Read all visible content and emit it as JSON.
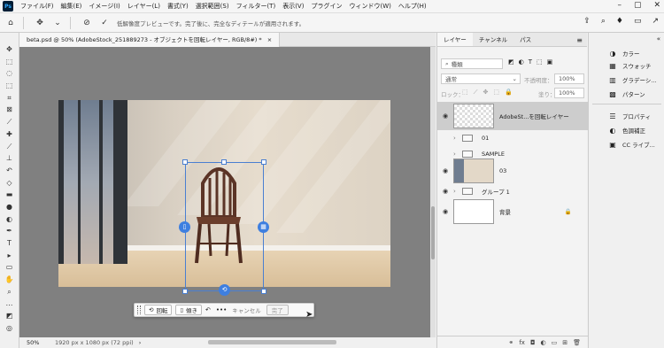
{
  "menubar": {
    "logo": "Ps",
    "items": [
      "ファイル(F)",
      "編集(E)",
      "イメージ(I)",
      "レイヤー(L)",
      "書式(Y)",
      "選択範囲(S)",
      "フィルター(T)",
      "表示(V)",
      "プラグイン",
      "ウィンドウ(W)",
      "ヘルプ(H)"
    ]
  },
  "optionsbar": {
    "message": "低解像度プレビューです。完了後に、完全なディテールが適用されます。"
  },
  "document": {
    "tab_title": "beta.psd @ 50% (AdobeStock_251889273 - オブジェクトを回転レイヤー, RGB/8#) *",
    "close": "×",
    "zoom": "50%",
    "info": "1920 px x 1080 px (72 ppi)"
  },
  "context_bar": {
    "rotate_label": "回転",
    "tilt_label": "傾き",
    "more": "•••",
    "cancel_label": "キャンセル",
    "done_label": "完了"
  },
  "layers_panel": {
    "tabs": [
      "レイヤー",
      "チャンネル",
      "パス"
    ],
    "filter_placeholder": "種類",
    "blend_mode": "通常",
    "opacity_label": "不透明度：",
    "opacity_value": "100%",
    "lock_label": "ロック：",
    "fill_label": "塗り：",
    "fill_value": "100%",
    "layers": [
      {
        "name": "AdobeSt...を回転レイヤー",
        "visible": true,
        "type": "smart"
      },
      {
        "name": "01",
        "visible": false,
        "type": "group"
      },
      {
        "name": "SAMPLE",
        "visible": false,
        "type": "group"
      },
      {
        "name": "03",
        "visible": true,
        "type": "image"
      },
      {
        "name": "グループ 1",
        "visible": true,
        "type": "group"
      },
      {
        "name": "背景",
        "visible": true,
        "type": "background"
      }
    ]
  },
  "right_panel": {
    "items": [
      "カラー",
      "スウォッチ",
      "グラデーシ...",
      "パターン",
      "プロパティ",
      "色調補正",
      "CC ライブ..."
    ]
  }
}
